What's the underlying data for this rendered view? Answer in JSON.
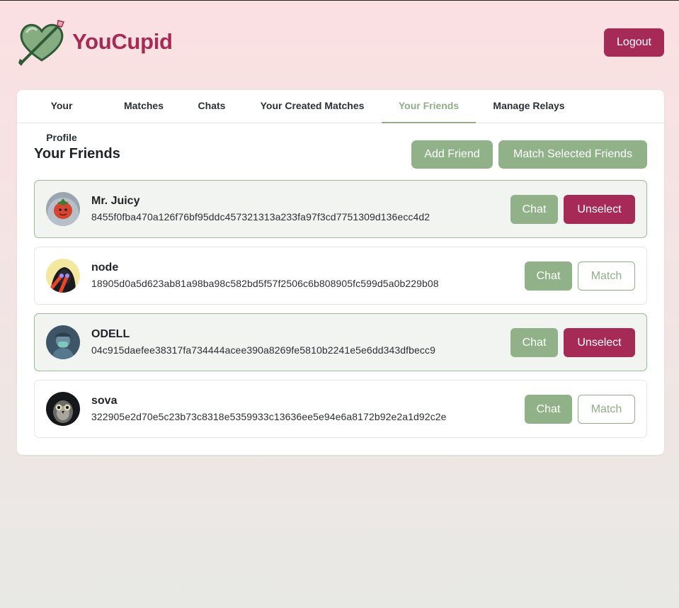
{
  "app": {
    "name": "YouCupid",
    "logout_label": "Logout",
    "logo_icon": "heart-arrow-logo-icon"
  },
  "colors": {
    "brand": "#a52a55",
    "accent_green": "#91b189",
    "selected_bg": "#f2f4f1"
  },
  "tabs": [
    {
      "label": "Your Profile",
      "active": false
    },
    {
      "label": "Matches",
      "active": false
    },
    {
      "label": "Chats",
      "active": false
    },
    {
      "label": "Your Created Matches",
      "active": false
    },
    {
      "label": "Your Friends",
      "active": true
    },
    {
      "label": "Manage Relays",
      "active": false
    }
  ],
  "friends_section": {
    "title": "Your Friends",
    "add_friend_label": "Add Friend",
    "match_selected_label": "Match Selected Friends"
  },
  "friends": [
    {
      "name": "Mr. Juicy",
      "pubkey": "8455f0fba470a126f76bf95ddc457321313a233fa97f3cd7751309d136ecc4d2",
      "selected": true,
      "chat_label": "Chat",
      "action_label": "Unselect",
      "avatar_icon": "tomato-avatar"
    },
    {
      "name": "node",
      "pubkey": "18905d0a5d623ab81a98ba98c582bd5f57f2506c6b808905fc599d5a0b229b08",
      "selected": false,
      "chat_label": "Chat",
      "action_label": "Match",
      "avatar_icon": "laser-eyes-avatar"
    },
    {
      "name": "ODELL",
      "pubkey": "04c915daefee38317fa734444acee390a8269fe5810b2241e5e6dd343dfbecc9",
      "selected": true,
      "chat_label": "Chat",
      "action_label": "Unselect",
      "avatar_icon": "masked-person-avatar"
    },
    {
      "name": "sova",
      "pubkey": "322905e2d70e5c23b73c8318e5359933c13636ee5e94e6a8172b92e2a1d92c2e",
      "selected": false,
      "chat_label": "Chat",
      "action_label": "Match",
      "avatar_icon": "owl-avatar"
    }
  ]
}
